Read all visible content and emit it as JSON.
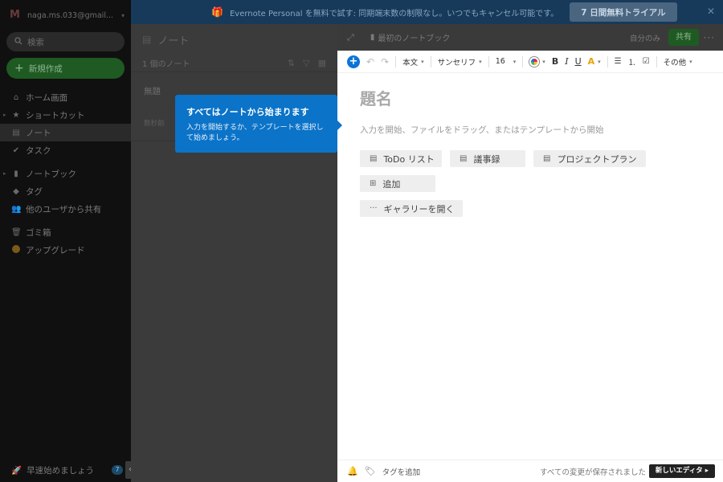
{
  "sidebar": {
    "account_email": "naga.ms.033@gmail...",
    "search_placeholder": "検索",
    "new_button": "新規作成",
    "items": [
      {
        "label": "ホーム画面"
      },
      {
        "label": "ショートカット"
      },
      {
        "label": "ノート"
      },
      {
        "label": "タスク"
      },
      {
        "label": "ノートブック"
      },
      {
        "label": "タグ"
      },
      {
        "label": "他のユーザから共有"
      },
      {
        "label": "ゴミ箱"
      },
      {
        "label": "アップグレード"
      }
    ],
    "get_started": "早速始めましょう",
    "get_started_badge": "7"
  },
  "banner": {
    "message": "Evernote Personal を無料で試す: 同期端末数の制限なし。いつでもキャンセル可能です。",
    "trial_button": "7 日間無料トライアル"
  },
  "note_list": {
    "title": "ノート",
    "count": "1 個のノート",
    "note": {
      "title": "無題",
      "date": "数秒前"
    }
  },
  "editor": {
    "notebook": "最初のノートブック",
    "only_me": "自分のみ",
    "share": "共有",
    "toolbar": {
      "style": "本文",
      "font": "サンセリフ",
      "size": "16",
      "more": "その他"
    },
    "title_placeholder": "題名",
    "body_placeholder": "入力を開始、ファイルをドラッグ、またはテンプレートから開始",
    "templates": [
      "ToDo リスト",
      "議事録",
      "プロジェクトプラン"
    ],
    "add": "追加",
    "gallery": "ギャラリーを開く",
    "add_tag": "タグを追加",
    "saved": "すべての変更が保存されました",
    "new_editor": "新しいエディタ"
  },
  "tooltip": {
    "heading": "すべてはノートから始まります",
    "body": "入力を開始するか、テンプレートを選択して始めましょう。"
  }
}
